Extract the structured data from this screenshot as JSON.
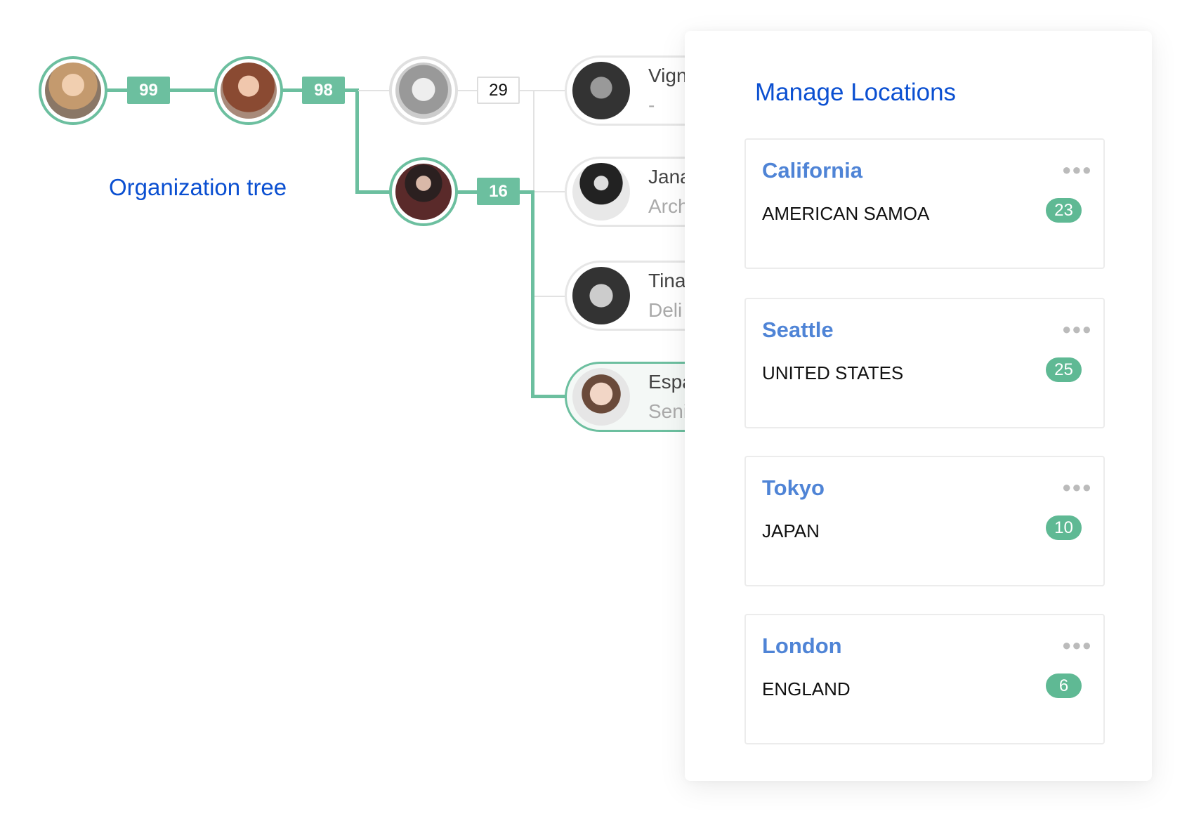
{
  "org_tree": {
    "title": "Organization tree",
    "chain": [
      {
        "avatar": "person-1",
        "count": "99"
      },
      {
        "avatar": "person-2",
        "count": "98"
      }
    ],
    "children": [
      {
        "avatar": "person-3",
        "count": "29",
        "highlight": false
      },
      {
        "avatar": "person-4",
        "count": "16",
        "highlight": true
      }
    ],
    "people": [
      {
        "name": "Vign",
        "role": "-",
        "selected": false
      },
      {
        "name": "Jana",
        "role": "Arch",
        "selected": false
      },
      {
        "name": "Tina",
        "role": "Deli",
        "selected": false
      },
      {
        "name": "Espa",
        "role": "Seni",
        "selected": true
      }
    ]
  },
  "locations_panel": {
    "title": "Manage Locations",
    "locations": [
      {
        "city": "California",
        "country": "AMERICAN SAMOA",
        "count": "23",
        "menu_icon": "more-horizontal-icon"
      },
      {
        "city": "Seattle",
        "country": "UNITED STATES",
        "count": "25",
        "menu_icon": "more-horizontal-icon"
      },
      {
        "city": "Tokyo",
        "country": "JAPAN",
        "count": "10",
        "menu_icon": "more-horizontal-icon"
      },
      {
        "city": "London",
        "country": "ENGLAND",
        "count": "6",
        "menu_icon": "more-horizontal-icon"
      }
    ]
  },
  "colors": {
    "accent_green": "#6cbf9f",
    "title_blue": "#0a4fd1",
    "city_blue": "#4f84d6"
  }
}
